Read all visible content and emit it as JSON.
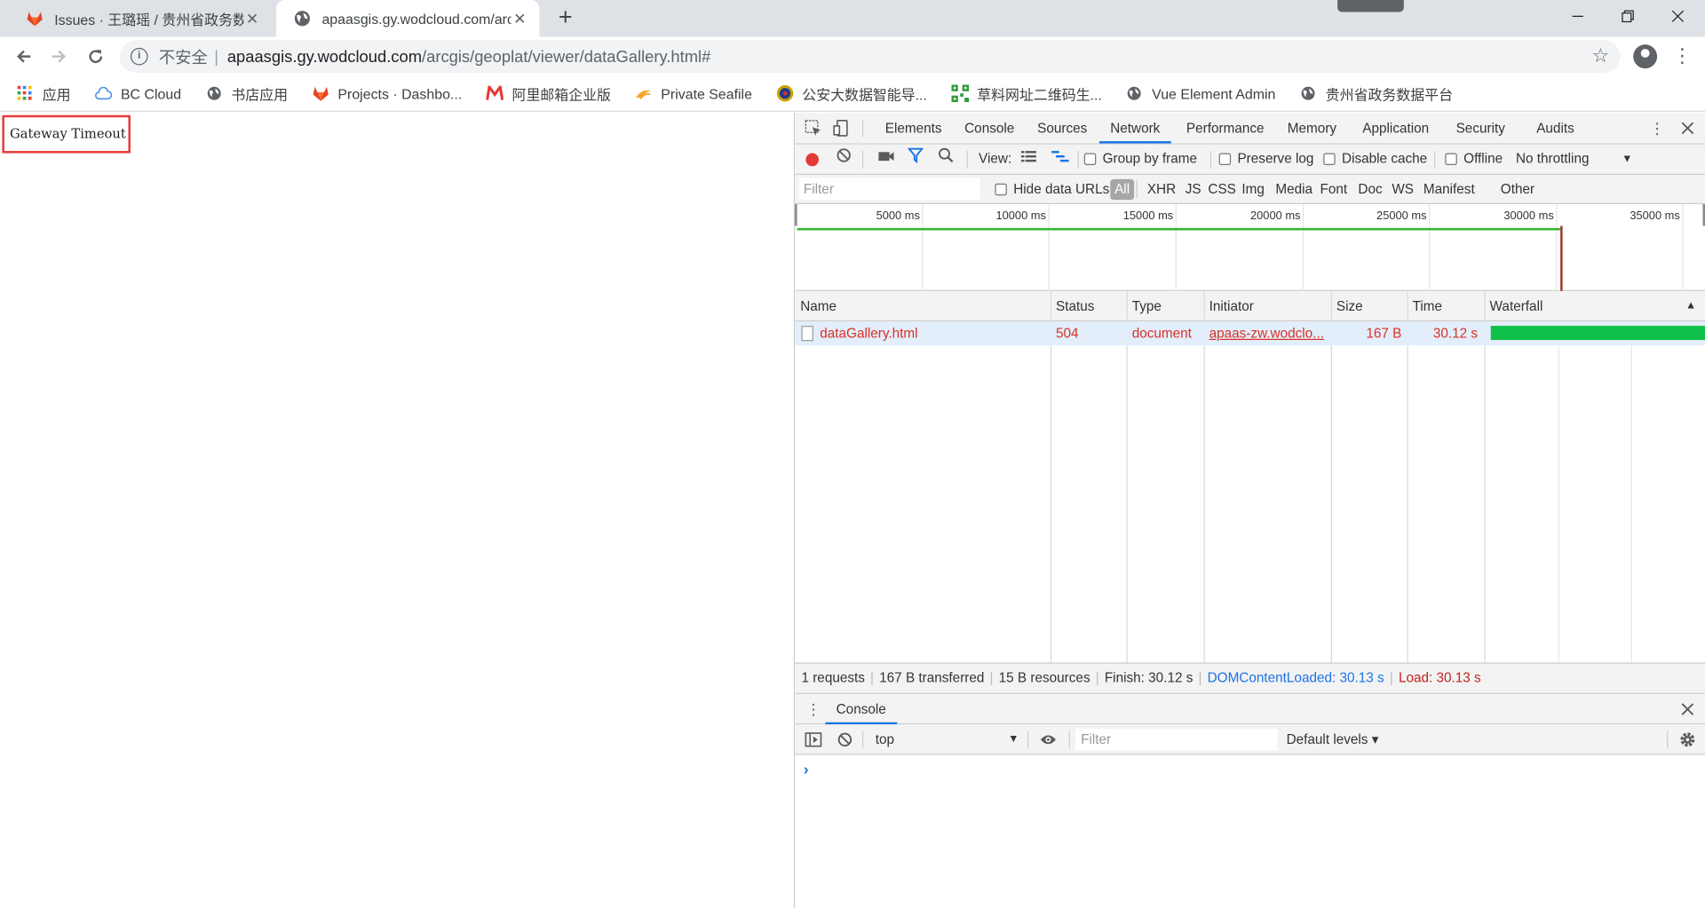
{
  "browser": {
    "tabs": [
      {
        "title": "Issues · 王璐瑶 / 贵州省政务数据",
        "active": false,
        "favicon": "gitlab-icon"
      },
      {
        "title": "apaasgis.gy.wodcloud.com/arc",
        "active": true,
        "favicon": "globe-icon"
      }
    ],
    "new_tab": "+",
    "address": {
      "insecure_label": "不安全",
      "separator": "|",
      "host": "apaasgis.gy.wodcloud.com",
      "path": "/arcgis/geoplat/viewer/dataGallery.html#"
    },
    "bookmarks": [
      {
        "label": "应用",
        "icon": "apps-grid-icon"
      },
      {
        "label": "BC Cloud",
        "icon": "cloud-icon"
      },
      {
        "label": "书店应用",
        "icon": "globe-icon"
      },
      {
        "label": "Projects · Dashbo...",
        "icon": "gitlab-icon"
      },
      {
        "label": "阿里邮箱企业版",
        "icon": "mail-icon"
      },
      {
        "label": "Private Seafile",
        "icon": "seafile-icon"
      },
      {
        "label": "公安大数据智能导...",
        "icon": "police-badge-icon"
      },
      {
        "label": "草料网址二维码生...",
        "icon": "qr-icon"
      },
      {
        "label": "Vue Element Admin",
        "icon": "globe-icon"
      },
      {
        "label": "贵州省政务数据平台",
        "icon": "globe-icon"
      }
    ]
  },
  "page": {
    "message": "Gateway Timeout"
  },
  "devtools": {
    "tabs": [
      "Elements",
      "Console",
      "Sources",
      "Network",
      "Performance",
      "Memory",
      "Application",
      "Security",
      "Audits"
    ],
    "active_tab": "Network",
    "toolbar": {
      "view_label": "View:",
      "group_by_frame": "Group by frame",
      "preserve_log": "Preserve log",
      "disable_cache": "Disable cache",
      "offline": "Offline",
      "throttling": "No throttling"
    },
    "filter": {
      "placeholder": "Filter",
      "hide_data_urls": "Hide data URLs",
      "types": [
        "All",
        "XHR",
        "JS",
        "CSS",
        "Img",
        "Media",
        "Font",
        "Doc",
        "WS",
        "Manifest",
        "Other"
      ],
      "active_type": "All"
    },
    "overview_ticks": [
      "5000 ms",
      "10000 ms",
      "15000 ms",
      "20000 ms",
      "25000 ms",
      "30000 ms",
      "35000 ms"
    ],
    "columns": [
      "Name",
      "Status",
      "Type",
      "Initiator",
      "Size",
      "Time",
      "Waterfall"
    ],
    "sort_indicator": "▲",
    "requests": [
      {
        "name": "dataGallery.html",
        "status": "504",
        "type": "document",
        "initiator": "apaas-zw.wodclo...",
        "size": "167 B",
        "time": "30.12 s"
      }
    ],
    "summary": {
      "requests": "1 requests",
      "transferred": "167 B transferred",
      "resources": "15 B resources",
      "finish": "Finish: 30.12 s",
      "dom_content_loaded": "DOMContentLoaded: 30.13 s",
      "load": "Load: 30.13 s"
    },
    "drawer": {
      "tab": "Console",
      "context": "top",
      "filter_placeholder": "Filter",
      "levels": "Default levels ▾",
      "prompt": "›"
    }
  },
  "colors": {
    "error_red": "#d93025",
    "accent_blue": "#1a73e8",
    "waterfall_green": "#10c04a"
  }
}
